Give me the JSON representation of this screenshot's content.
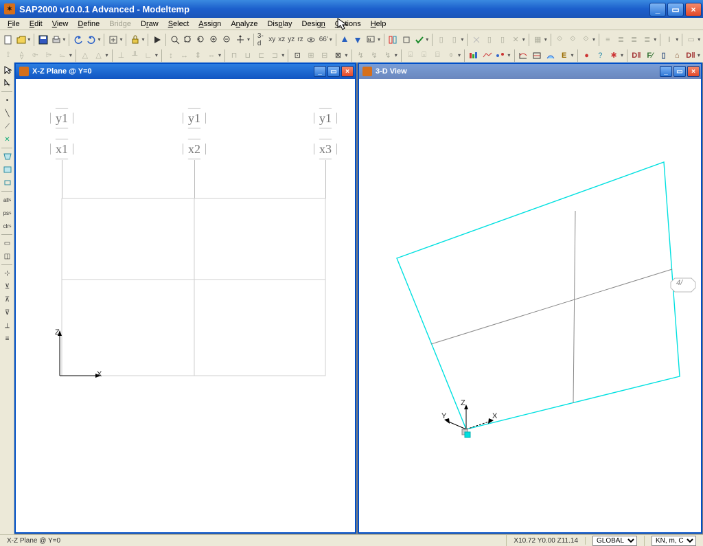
{
  "title": "SAP2000 v10.0.1 Advanced  - Modeltemp",
  "menus": [
    "File",
    "Edit",
    "View",
    "Define",
    "Bridge",
    "Draw",
    "Select",
    "Assign",
    "Analyze",
    "Display",
    "Design",
    "Options",
    "Help"
  ],
  "menus_disabled": [
    "Bridge"
  ],
  "toolbar_labels": {
    "view3d": "3-d",
    "xy": "xy",
    "xz": "xz",
    "yz": "yz",
    "rz": "rz",
    "gg": "66'"
  },
  "child_xz": {
    "title": "X-Z Plane @ Y=0"
  },
  "child_3d": {
    "title": "3-D View"
  },
  "grid_labels": {
    "y1": "y1",
    "x1": "x1",
    "x2": "x2",
    "x3": "x3"
  },
  "axes_2d": {
    "z": "Z",
    "x": "X"
  },
  "axes_3d": {
    "y": "Y",
    "z": "Z",
    "x": "X",
    "label": "4/"
  },
  "status": {
    "left": "X-Z Plane @ Y=0",
    "coords": "X10.72  Y0.00  Z11.14",
    "coord_sys": "GLOBAL",
    "units": "KN, m, C"
  }
}
